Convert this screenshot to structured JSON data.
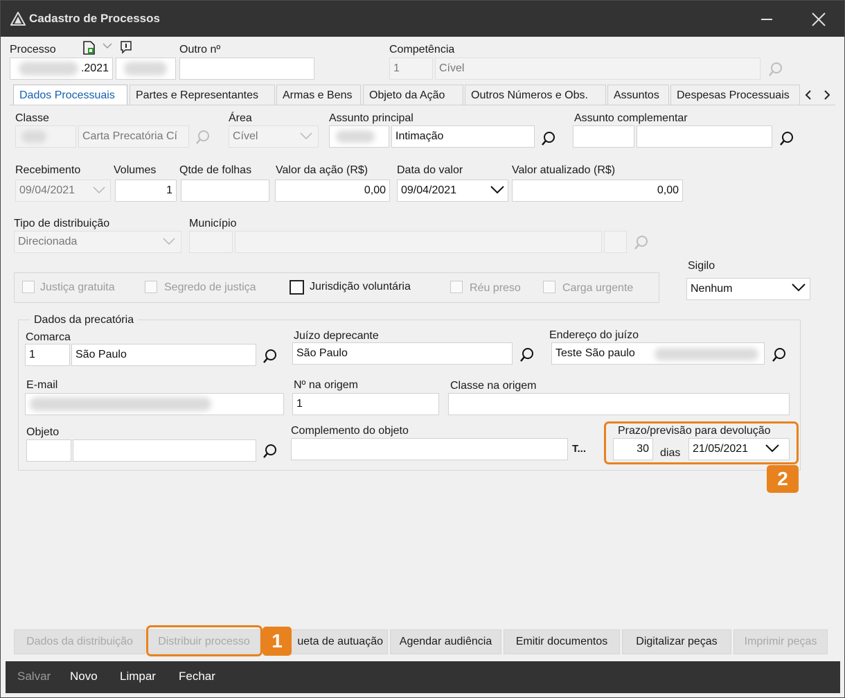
{
  "window": {
    "title": "Cadastro de Processos"
  },
  "header": {
    "processo_label": "Processo",
    "processo_value": ".2021",
    "outro_label": "Outro nº",
    "competencia_label": "Competência",
    "competencia_code": "1",
    "competencia_name": "Cível"
  },
  "tabs": [
    {
      "label": "Dados Processuais"
    },
    {
      "label": "Partes e Representantes"
    },
    {
      "label": "Armas e Bens"
    },
    {
      "label": "Objeto da Ação"
    },
    {
      "label": "Outros Números e Obs."
    },
    {
      "label": "Assuntos"
    },
    {
      "label": "Despesas Processuais"
    }
  ],
  "fields": {
    "classe_label": "Classe",
    "classe_value": "Carta Precatória Cí",
    "area_label": "Área",
    "area_value": "Cível",
    "assunto_principal_label": "Assunto principal",
    "assunto_principal_value": "Intimação",
    "assunto_complementar_label": "Assunto complementar",
    "recebimento_label": "Recebimento",
    "recebimento_value": "09/04/2021",
    "volumes_label": "Volumes",
    "volumes_value": "1",
    "folhas_label": "Qtde de folhas",
    "valor_acao_label": "Valor da ação (R$)",
    "valor_acao_value": "0,00",
    "data_valor_label": "Data do valor",
    "data_valor_value": "09/04/2021",
    "valor_atualizado_label": "Valor atualizado (R$)",
    "valor_atualizado_value": "0,00",
    "tipo_distribuicao_label": "Tipo de distribuição",
    "tipo_distribuicao_value": "Direcionada",
    "municipio_label": "Município",
    "sigilo_label": "Sigilo",
    "sigilo_value": "Nenhum"
  },
  "checkboxes": [
    {
      "label": "Justiça gratuita",
      "checked": false,
      "enabled": false
    },
    {
      "label": "Segredo de justiça",
      "checked": false,
      "enabled": false
    },
    {
      "label": "Jurisdição voluntária",
      "checked": false,
      "enabled": true
    },
    {
      "label": "Réu preso",
      "checked": false,
      "enabled": false
    },
    {
      "label": "Carga urgente",
      "checked": false,
      "enabled": false
    }
  ],
  "precatoria": {
    "group_label": "Dados da precatória",
    "comarca_label": "Comarca",
    "comarca_code": "1",
    "comarca_name": "São Paulo",
    "juizo_label": "Juízo deprecante",
    "juizo_value": "São Paulo",
    "endereco_label": "Endereço do juízo",
    "endereco_value": "Teste São paulo",
    "email_label": "E-mail",
    "num_origem_label": "Nº na origem",
    "num_origem_value": "1",
    "classe_origem_label": "Classe na origem",
    "objeto_label": "Objeto",
    "complemento_label": "Complemento do objeto",
    "t_button": "T...",
    "prazo_label": "Prazo/previsão para devolução",
    "prazo_dias": "30",
    "dias_label": "dias",
    "prazo_data": "21/05/2021"
  },
  "actions": [
    {
      "label": "Dados da distribuição",
      "enabled": false
    },
    {
      "label": "Distribuir processo",
      "enabled": false
    },
    {
      "label": "ueta de autuação",
      "enabled": true
    },
    {
      "label": "Agendar audiência",
      "enabled": true
    },
    {
      "label": "Emitir documentos",
      "enabled": true
    },
    {
      "label": "Digitalizar peças",
      "enabled": true
    },
    {
      "label": "Imprimir peças",
      "enabled": false
    }
  ],
  "bottom": {
    "salvar": "Salvar",
    "novo": "Novo",
    "limpar": "Limpar",
    "fechar": "Fechar"
  },
  "callouts": {
    "one": "1",
    "two": "2"
  },
  "colors": {
    "accent": "#e8821e",
    "titlebar": "#333333",
    "tab_active": "#1460b0"
  }
}
